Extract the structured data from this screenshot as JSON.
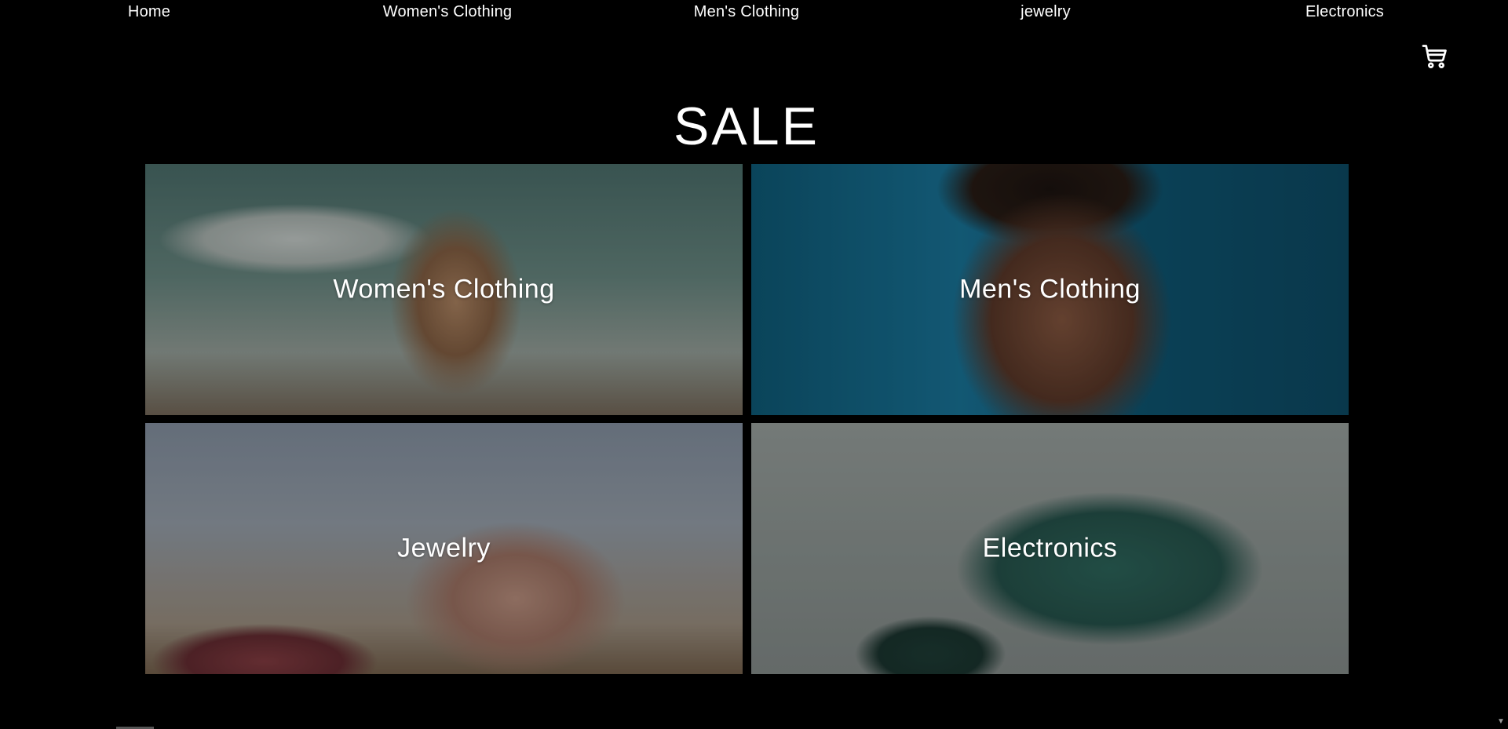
{
  "nav": {
    "items": [
      {
        "label": "Home"
      },
      {
        "label": "Women's Clothing"
      },
      {
        "label": "Men's Clothing"
      },
      {
        "label": "jewelry"
      },
      {
        "label": "Electronics"
      }
    ]
  },
  "header": {
    "cart_icon": "cart-icon"
  },
  "main": {
    "title": "SALE",
    "categories": [
      {
        "label": "Women's Clothing",
        "image": "woman-in-sunglasses-photo"
      },
      {
        "label": "Men's Clothing",
        "image": "man-portrait-photo"
      },
      {
        "label": "Jewelry",
        "image": "hand-with-rings-photo"
      },
      {
        "label": "Electronics",
        "image": "phone-and-watch-photo"
      }
    ]
  },
  "colors": {
    "background": "#000000",
    "text": "#ffffff"
  }
}
